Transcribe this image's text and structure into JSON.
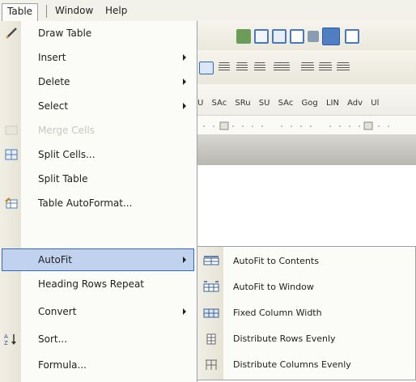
{
  "menubar": {
    "items": [
      {
        "label": "Table",
        "state": "open"
      },
      {
        "label": "Window"
      },
      {
        "label": "Help"
      }
    ]
  },
  "table_menu": {
    "items": [
      {
        "label": "Draw Table",
        "icon": "pencil-icon",
        "submenu": false,
        "enabled": true
      },
      {
        "label": "Insert",
        "icon": "",
        "submenu": true,
        "enabled": true
      },
      {
        "label": "Delete",
        "icon": "",
        "submenu": true,
        "enabled": true
      },
      {
        "label": "Select",
        "icon": "",
        "submenu": true,
        "enabled": true
      },
      {
        "label": "Merge Cells",
        "icon": "merge-cells-icon",
        "submenu": false,
        "enabled": false
      },
      {
        "label": "Split Cells...",
        "icon": "split-cells-icon",
        "submenu": false,
        "enabled": true
      },
      {
        "label": "Split Table",
        "icon": "",
        "submenu": false,
        "enabled": true
      },
      {
        "label": "Table AutoFormat...",
        "icon": "table-autoformat-icon",
        "submenu": false,
        "enabled": true
      },
      {
        "label": "AutoFit",
        "icon": "",
        "submenu": true,
        "enabled": true,
        "highlighted": true
      },
      {
        "label": "Heading Rows Repeat",
        "icon": "",
        "submenu": false,
        "enabled": true
      },
      {
        "label": "Convert",
        "icon": "",
        "submenu": true,
        "enabled": true
      },
      {
        "label": "Sort...",
        "icon": "sort-icon",
        "submenu": false,
        "enabled": true
      },
      {
        "label": "Formula...",
        "icon": "",
        "submenu": false,
        "enabled": true
      }
    ]
  },
  "autofit_submenu": {
    "items": [
      {
        "label": "AutoFit to Contents",
        "icon": "autofit-contents-icon"
      },
      {
        "label": "AutoFit to Window",
        "icon": "autofit-window-icon"
      },
      {
        "label": "Fixed Column Width",
        "icon": "fixed-column-width-icon"
      },
      {
        "label": "Distribute Rows Evenly",
        "icon": "distribute-rows-icon"
      },
      {
        "label": "Distribute Columns Evenly",
        "icon": "distribute-columns-icon"
      }
    ]
  },
  "styles_toolbar": {
    "items": [
      "U",
      "SAc",
      "SRu",
      "SU",
      "SAc",
      "Gog",
      "LIN",
      "Adv",
      "Ul"
    ]
  },
  "colors": {
    "highlight_fill": "#c1d2ee",
    "highlight_border": "#316ac5",
    "menu_bg": "#fbfbf8",
    "gutter": "#e6e3d6"
  }
}
